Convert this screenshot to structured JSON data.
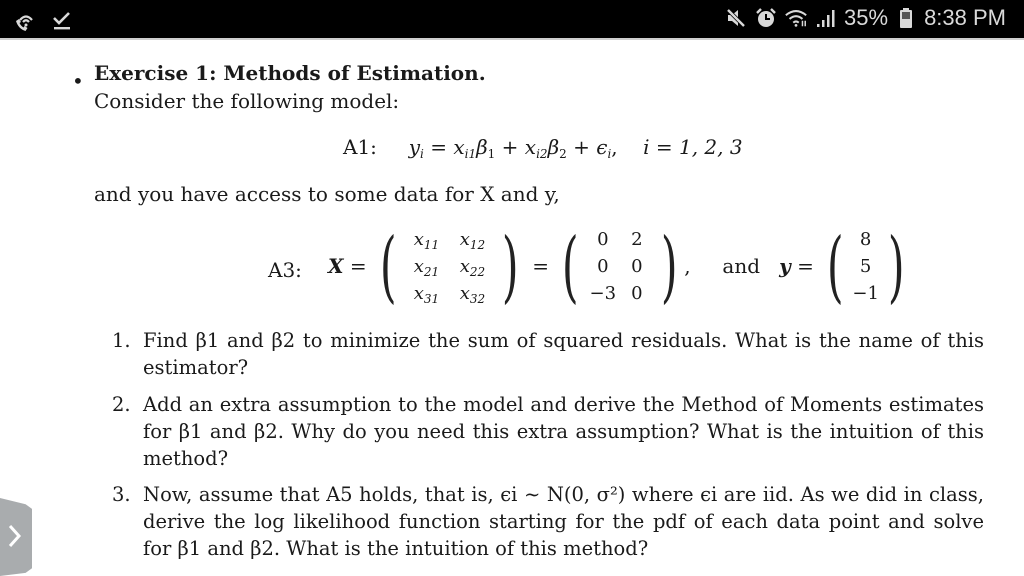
{
  "status_bar": {
    "left_icons": [
      "wifi-calling-icon",
      "download-complete-icon"
    ],
    "right_icons": [
      "mute-icon",
      "alarm-icon",
      "wifi-icon",
      "signal-icon",
      "battery-icon"
    ],
    "battery": "35%",
    "time": "8:38 PM"
  },
  "document": {
    "bullet": "•",
    "heading": "Exercise 1: Methods of Estimation.",
    "intro": "Consider the following model:",
    "equation_a1": {
      "label": "A1:",
      "lhs": "y",
      "lhs_sub": "i",
      "rhs_terms": [
        "x",
        "i1",
        "β",
        "1",
        "+",
        "x",
        "i2",
        "β",
        "2",
        "+",
        "ϵ",
        "i"
      ],
      "index_text": "i = 1, 2, 3"
    },
    "data_sentence": "and you have access to some data for X and y,",
    "equation_a3": {
      "label": "A3:",
      "X_symbol": "X",
      "symbolic_matrix": [
        [
          "x11",
          "x12"
        ],
        [
          "x21",
          "x22"
        ],
        [
          "x31",
          "x32"
        ]
      ],
      "numeric_matrix": [
        [
          "0",
          "2"
        ],
        [
          "0",
          "0"
        ],
        [
          "−3",
          "0"
        ]
      ],
      "connector": "and",
      "y_symbol": "y",
      "y_vector": [
        "8",
        "5",
        "−1"
      ]
    },
    "questions": [
      {
        "number": "1.",
        "text": "Find β1 and β2 to minimize the sum of squared residuals. What is the name of this estimator?"
      },
      {
        "number": "2.",
        "text": "Add an extra assumption to the model and derive the Method of Moments estimates for β1 and β2. Why do you need this extra assumption? What is the intuition of this method?"
      },
      {
        "number": "3.",
        "text": "Now, assume that A5 holds, that is, ϵi ∼ N(0, σ²) where ϵi are iid. As we did in class, derive the log likelihood function starting for the pdf of each data point and solve for β1 and β2. What is the intuition of this method?"
      }
    ]
  },
  "side_handle": {
    "icon": "chevron-right-icon"
  }
}
